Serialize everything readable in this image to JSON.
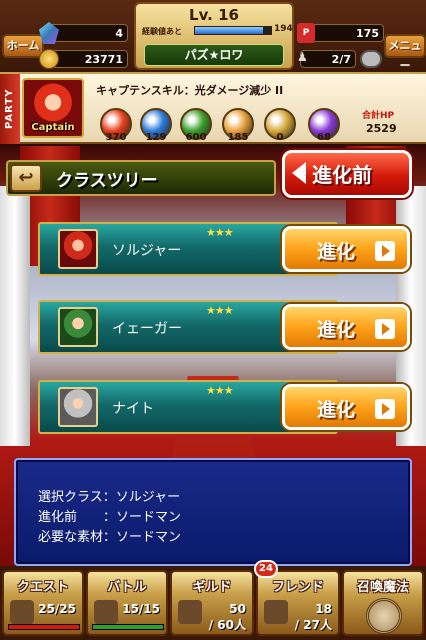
{
  "header": {
    "home_label": "ホーム",
    "menu_label": "メニュー",
    "gems": "4",
    "coins": "23771",
    "level": "Lv. 16",
    "exp_label": "経験値あと",
    "exp_remaining": "194",
    "exp_fraction": 0.9,
    "player_name": "パズ★ロワ",
    "stamina": "175",
    "friends": "2/7"
  },
  "party": {
    "tag": "PARTY",
    "captain_label": "Captain",
    "captain_skill": "キャプテンスキル：光ダメージ減少 II",
    "stats": [
      {
        "icon": "fire-orb-icon",
        "value": "370",
        "color": "#e8401a"
      },
      {
        "icon": "water-orb-icon",
        "value": "129",
        "color": "#2a7ad8"
      },
      {
        "icon": "wood-orb-icon",
        "value": "600",
        "color": "#3aa02a"
      },
      {
        "icon": "light-orb-icon",
        "value": "185",
        "color": "#e8a03a"
      },
      {
        "icon": "dark-star-icon",
        "value": "0",
        "color": "#d4a83a"
      },
      {
        "icon": "dark-orb-icon",
        "value": "68",
        "color": "#8a3ad8"
      }
    ],
    "total_hp_label": "合計HP",
    "total_hp": "2529"
  },
  "class_tree": {
    "title": "クラスツリー",
    "pre_evolution_label": "進化前",
    "rows": [
      {
        "name": "ソルジャー",
        "stars": "★★★",
        "button": "進化"
      },
      {
        "name": "イェーガー",
        "stars": "★★★",
        "button": "進化"
      },
      {
        "name": "ナイト",
        "stars": "★★★",
        "button": "進化"
      }
    ]
  },
  "info": {
    "line1": "選択クラス：ソルジャー",
    "line2": "進化前　　：ソードマン",
    "line3": "必要な素材：ソードマン"
  },
  "nav": {
    "quest": {
      "label": "クエスト",
      "count": "25/25",
      "fill": 1.0
    },
    "battle": {
      "label": "バトル",
      "count": "15/15",
      "fill": 1.0
    },
    "guild": {
      "label": "ギルド",
      "count1": "50",
      "count2": "/ 60人",
      "badge": "24"
    },
    "friend": {
      "label": "フレンド",
      "count1": "18",
      "count2": "/ 27人"
    },
    "summon": {
      "label": "召喚魔法"
    }
  }
}
